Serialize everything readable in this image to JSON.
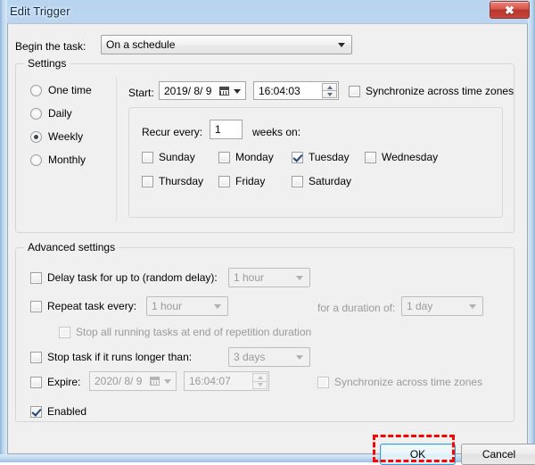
{
  "window": {
    "title": "Edit Trigger",
    "close_icon": "close-x-icon"
  },
  "begin": {
    "label": "Begin the task:",
    "value": "On a schedule"
  },
  "settings": {
    "legend": "Settings",
    "frequency_options": [
      "One time",
      "Daily",
      "Weekly",
      "Monthly"
    ],
    "selected_frequency": "Weekly",
    "start": {
      "label": "Start:",
      "date": "2019/ 8/ 9",
      "time": "16:04:03",
      "calendar_icon": "calendar-icon"
    },
    "sync_time_zones": {
      "label": "Synchronize across time zones",
      "checked": false
    },
    "recur": {
      "label": "Recur every:",
      "value": "1",
      "suffix": "weeks on:"
    },
    "weekdays": [
      {
        "label": "Sunday",
        "checked": false
      },
      {
        "label": "Monday",
        "checked": false
      },
      {
        "label": "Tuesday",
        "checked": true
      },
      {
        "label": "Wednesday",
        "checked": false
      },
      {
        "label": "Thursday",
        "checked": false
      },
      {
        "label": "Friday",
        "checked": false
      },
      {
        "label": "Saturday",
        "checked": false
      }
    ]
  },
  "advanced": {
    "legend": "Advanced settings",
    "delay": {
      "label": "Delay task for up to (random delay):",
      "checked": false,
      "value": "1 hour"
    },
    "repeat": {
      "label": "Repeat task every:",
      "checked": false,
      "value": "1 hour",
      "duration_label": "for a duration of:",
      "duration_value": "1 day"
    },
    "stop_at_end": {
      "label": "Stop all running tasks at end of repetition duration",
      "checked": false
    },
    "stop_longer": {
      "label": "Stop task if it runs longer than:",
      "checked": false,
      "value": "3 days"
    },
    "expire": {
      "label": "Expire:",
      "checked": false,
      "date": "2020/ 8/ 9",
      "time": "16:04:07",
      "calendar_icon": "calendar-icon"
    },
    "expire_sync": {
      "label": "Synchronize across time zones",
      "checked": false
    },
    "enabled": {
      "label": "Enabled",
      "checked": true
    }
  },
  "footer": {
    "ok_label": "OK",
    "cancel_label": "Cancel"
  },
  "colors": {
    "accent": "#3c9ad6",
    "annotation": "#ff0000",
    "close_button": "#c9453b"
  }
}
